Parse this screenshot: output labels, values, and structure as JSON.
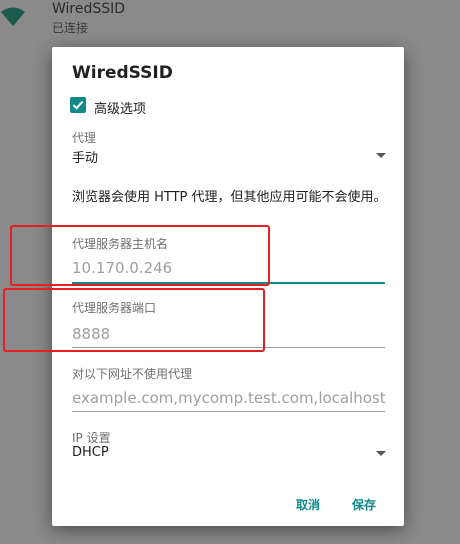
{
  "background": {
    "ssid": "WiredSSID",
    "status": "已连接"
  },
  "dialog": {
    "title": "WiredSSID",
    "advanced_label": "高级选项",
    "advanced_checked": true,
    "proxy": {
      "label": "代理",
      "value": "手动"
    },
    "info_text": "浏览器会使用 HTTP 代理，但其他应用可能不会使用。",
    "proxy_host": {
      "label": "代理服务器主机名",
      "placeholder": "10.170.0.246"
    },
    "proxy_port": {
      "label": "代理服务器端口",
      "placeholder": "8888"
    },
    "bypass": {
      "label": "对以下网址不使用代理",
      "placeholder": "example.com,mycomp.test.com,localhost"
    },
    "ip_settings": {
      "label": "IP 设置",
      "value": "DHCP"
    },
    "buttons": {
      "cancel": "取消",
      "save": "保存"
    }
  },
  "colors": {
    "accent": "#128a8a",
    "annotation": "#e62020"
  }
}
